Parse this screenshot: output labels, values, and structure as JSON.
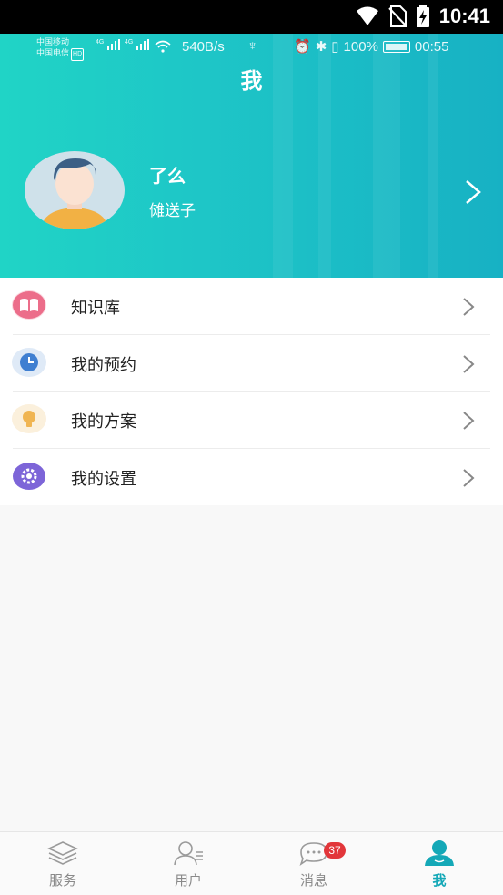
{
  "system_bar": {
    "time": "10:41"
  },
  "inner_status": {
    "carrier1": "中国移动",
    "carrier2": "中国电信",
    "hd": "HD",
    "signal1": "4G",
    "signal2": "4G",
    "speed": "540B/s",
    "battery": "100%",
    "clock": "00:55"
  },
  "header": {
    "title": "我",
    "user_name": "了么",
    "user_subtitle": "傩送子"
  },
  "menu": {
    "items": [
      {
        "label": "知识库",
        "icon": "book-icon",
        "color": "#ec6d8a"
      },
      {
        "label": "我的预约",
        "icon": "clock-icon",
        "color": "#3f7fd1"
      },
      {
        "label": "我的方案",
        "icon": "lightbulb-icon",
        "color": "#f0b552"
      },
      {
        "label": "我的设置",
        "icon": "gear-icon",
        "color": "#7d65d8"
      }
    ]
  },
  "tabbar": {
    "tabs": [
      {
        "label": "服务",
        "icon": "layers-icon"
      },
      {
        "label": "用户",
        "icon": "users-icon"
      },
      {
        "label": "消息",
        "icon": "chat-icon",
        "badge": "37"
      },
      {
        "label": "我",
        "icon": "person-icon",
        "active": true
      }
    ]
  },
  "colors": {
    "accent": "#14a8b7",
    "header_start": "#20d4c6",
    "header_end": "#17b1c4",
    "badge": "#e2363a"
  }
}
